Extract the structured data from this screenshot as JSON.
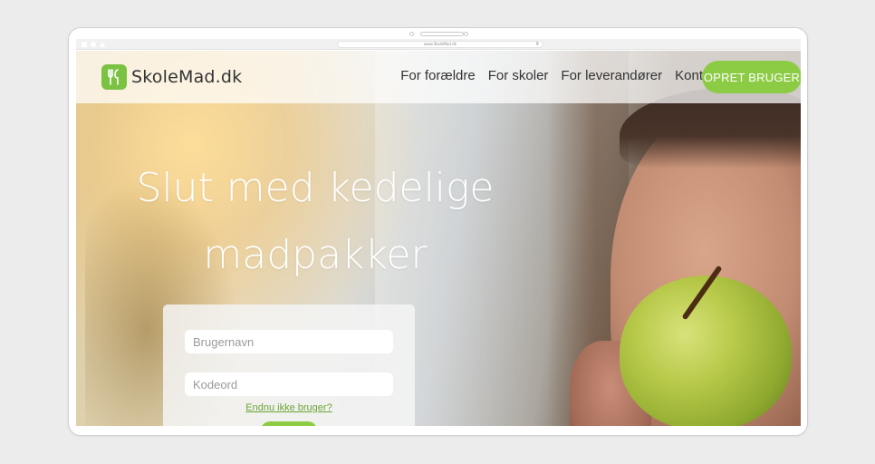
{
  "browser": {
    "url": "www.SkoleMad.dk"
  },
  "brand": {
    "name": "SkoleMad.dk",
    "accent_color": "#8ccc45",
    "logo_icon": "fork-spoon-icon"
  },
  "nav": {
    "links": [
      {
        "label": "For forældre"
      },
      {
        "label": "For skoler"
      },
      {
        "label": "For leverandører"
      },
      {
        "label": "Kontakt"
      }
    ],
    "cta_label": "OPRET BRUGER"
  },
  "hero": {
    "headline_line1": "Slut med kedelige",
    "headline_line2": "madpakker"
  },
  "login": {
    "username_placeholder": "Brugernavn",
    "password_placeholder": "Kodeord",
    "signup_link": "Endnu ikke bruger?"
  }
}
